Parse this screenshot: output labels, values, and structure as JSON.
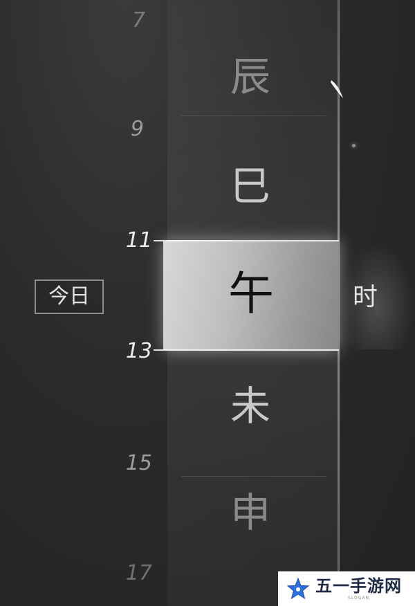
{
  "time_wheel": {
    "hour_marks": [
      "7",
      "9",
      "11",
      "13",
      "15",
      "17"
    ],
    "branches": {
      "chen": "辰",
      "si": "巳",
      "wu": "午",
      "wei": "未",
      "shen": "申"
    },
    "selected_branch": "午",
    "unit_label": "时"
  },
  "today_button": {
    "label": "今日"
  },
  "watermark": {
    "text": "五一手游网",
    "slogan": "SLOGAN"
  },
  "colors": {
    "background": "#2a2a2a",
    "highlight": "#d0d0d0",
    "text_light": "#e4e4e4",
    "text_dim": "#8a8a8a",
    "watermark_star": "#2f6fe0"
  }
}
